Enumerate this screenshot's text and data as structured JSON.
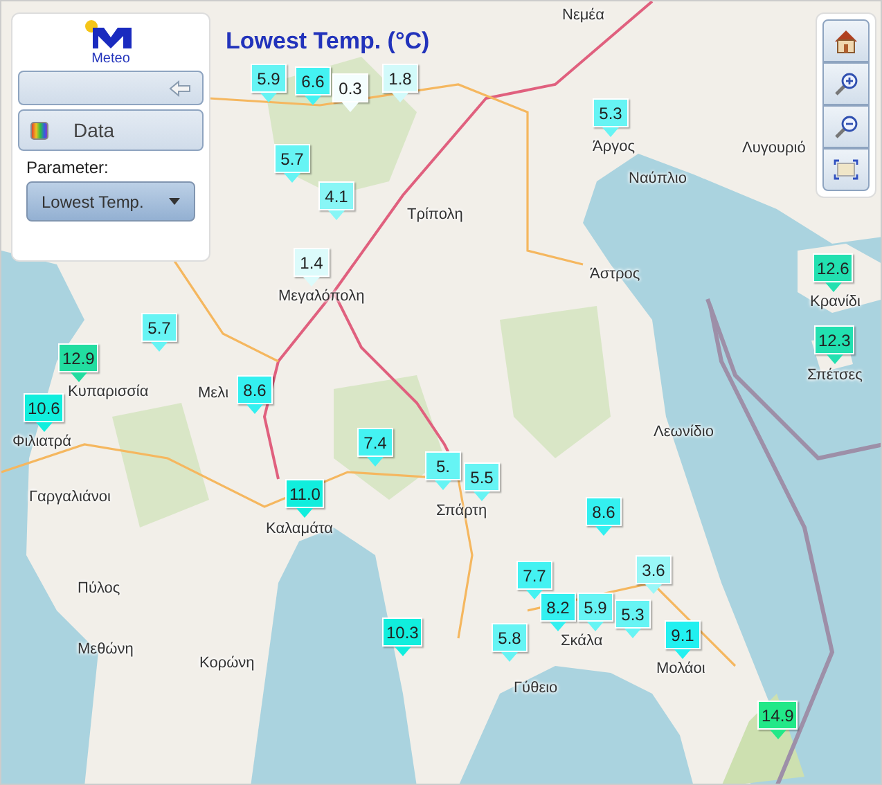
{
  "title": "Lowest Temp. (°C)",
  "panel": {
    "logo_text": "Meteo",
    "data_button": "Data",
    "parameter_label": "Parameter:",
    "parameter_select": "Lowest Temp."
  },
  "toolbar": [
    {
      "kind": "home"
    },
    {
      "kind": "zoom-in"
    },
    {
      "kind": "zoom-out"
    },
    {
      "kind": "extent"
    }
  ],
  "places": [
    {
      "name": "Νεμέα"
    },
    {
      "name": "Άργος"
    },
    {
      "name": "Ναύπλιο"
    },
    {
      "name": "Λυγουριό"
    },
    {
      "name": "Τρίπολη"
    },
    {
      "name": "Μεγαλόπολη"
    },
    {
      "name": "Άστρος"
    },
    {
      "name": "Κρανίδι"
    },
    {
      "name": "Σπέτσες"
    },
    {
      "name": "Κυπαρισσία"
    },
    {
      "name": "Φιλιατρά"
    },
    {
      "name": "Μελι"
    },
    {
      "name": "Γαργαλιάνοι"
    },
    {
      "name": "Καλαμάτα"
    },
    {
      "name": "Σπάρτη"
    },
    {
      "name": "Λεωνίδιο"
    },
    {
      "name": "Πύλος"
    },
    {
      "name": "Μεθώνη"
    },
    {
      "name": "Κορώνη"
    },
    {
      "name": "Γύθειο"
    },
    {
      "name": "Σκάλα"
    },
    {
      "name": "Μολάοι"
    }
  ],
  "markers": [
    {
      "value": "5.9",
      "color": "#66f4f4"
    },
    {
      "value": "6.6",
      "color": "#44f2f2"
    },
    {
      "value": "0.3",
      "color": "#f4fefe"
    },
    {
      "value": "1.8",
      "color": "#d2fafa"
    },
    {
      "value": "5.3",
      "color": "#66f4f4"
    },
    {
      "value": "5.7",
      "color": "#66f4f4"
    },
    {
      "value": "4.1",
      "color": "#88f6f6"
    },
    {
      "value": "1.4",
      "color": "#dcfbfb"
    },
    {
      "value": "12.6",
      "color": "#22e0b0"
    },
    {
      "value": "12.3",
      "color": "#22e0b0"
    },
    {
      "value": "5.7",
      "color": "#66f4f4"
    },
    {
      "value": "12.9",
      "color": "#22dda0"
    },
    {
      "value": "10.6",
      "color": "#11eedd"
    },
    {
      "value": "8.6",
      "color": "#33f0f0"
    },
    {
      "value": "7.4",
      "color": "#44f2f2"
    },
    {
      "value": "5.",
      "color": "#66f4f4"
    },
    {
      "value": "5.5",
      "color": "#66f4f4"
    },
    {
      "value": "11.0",
      "color": "#11eedd"
    },
    {
      "value": "8.6",
      "color": "#33f0f0"
    },
    {
      "value": "7.7",
      "color": "#44f2f2"
    },
    {
      "value": "3.6",
      "color": "#99f7f7"
    },
    {
      "value": "8.2",
      "color": "#33f0f0"
    },
    {
      "value": "5.9",
      "color": "#66f4f4"
    },
    {
      "value": "5.3",
      "color": "#66f4f4"
    },
    {
      "value": "5.8",
      "color": "#66f4f4"
    },
    {
      "value": "10.3",
      "color": "#11eedd"
    },
    {
      "value": "9.1",
      "color": "#22f0f0"
    },
    {
      "value": "14.9",
      "color": "#22e888"
    }
  ]
}
